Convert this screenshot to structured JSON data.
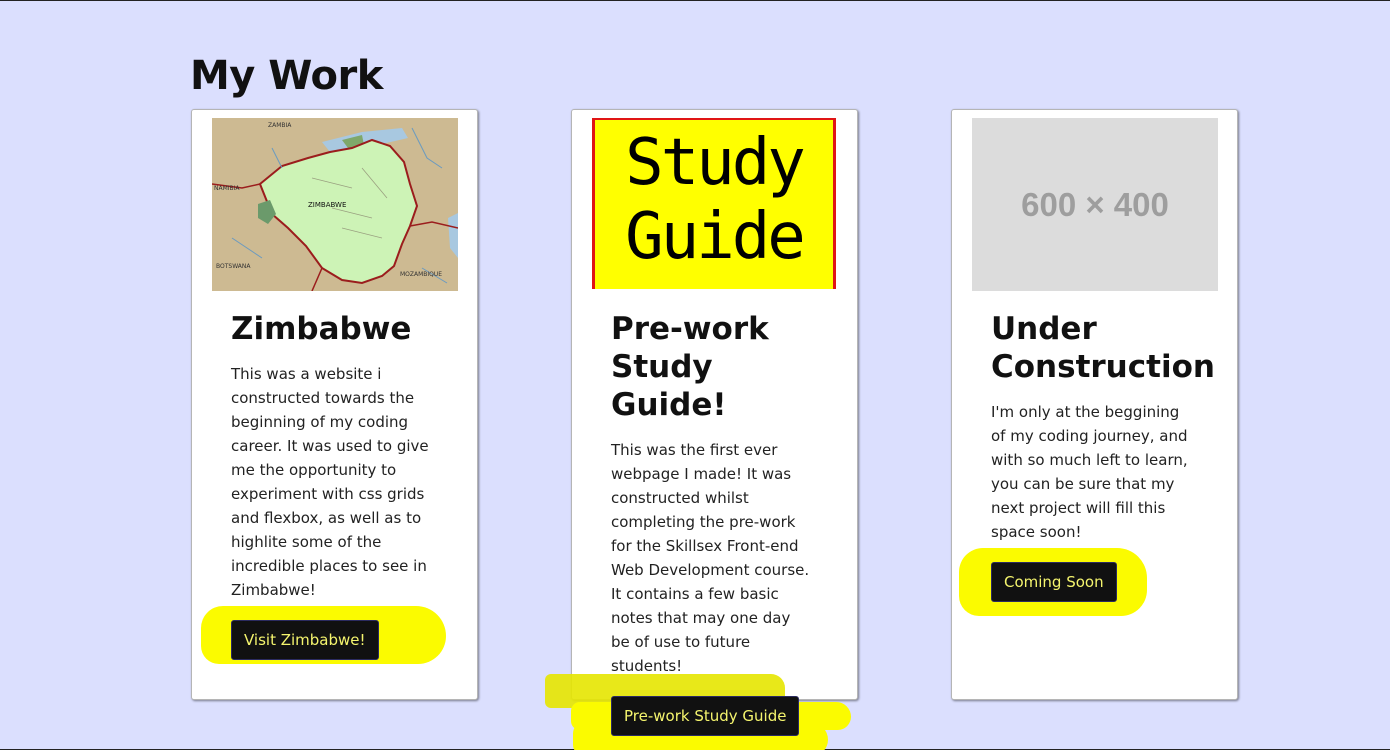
{
  "section_title": "My Work",
  "colors": {
    "page_background": "#dbdffe",
    "button_background": "#111111",
    "button_text": "#f5f56e",
    "highlight": "#fbfb00"
  },
  "cards": [
    {
      "image": {
        "type": "map",
        "labels": [
          "ZAMBIA",
          "NAMIBIA",
          "ZIMBABWE",
          "BOTSWANA",
          "MOZAMBIQUE"
        ]
      },
      "title": "Zimbabwe",
      "text": "This was a website i constructed towards the beginning of my coding career. It was used to give me the opportunity to experiment with css grids and flexbox, as well as to highlite some of the incredible places to see in Zimbabwe!",
      "button_label": "Visit Zimbabwe!"
    },
    {
      "image": {
        "type": "study-guide",
        "line1": "Study",
        "line2": "Guide"
      },
      "title": "Pre-work Study Guide!",
      "text": "This was the first ever webpage I made! It was constructed whilst completing the pre-work for the Skillsex Front-end Web Development course. It contains a few basic notes that may one day be of use to future students!",
      "button_label": "Pre-work Study Guide"
    },
    {
      "image": {
        "type": "placeholder",
        "label": "600 × 400"
      },
      "title": "Under Construction",
      "text": "I'm only at the beggining of my coding journey, and with so much left to learn, you can be sure that my next project will fill this space soon!",
      "button_label": "Coming Soon"
    }
  ]
}
